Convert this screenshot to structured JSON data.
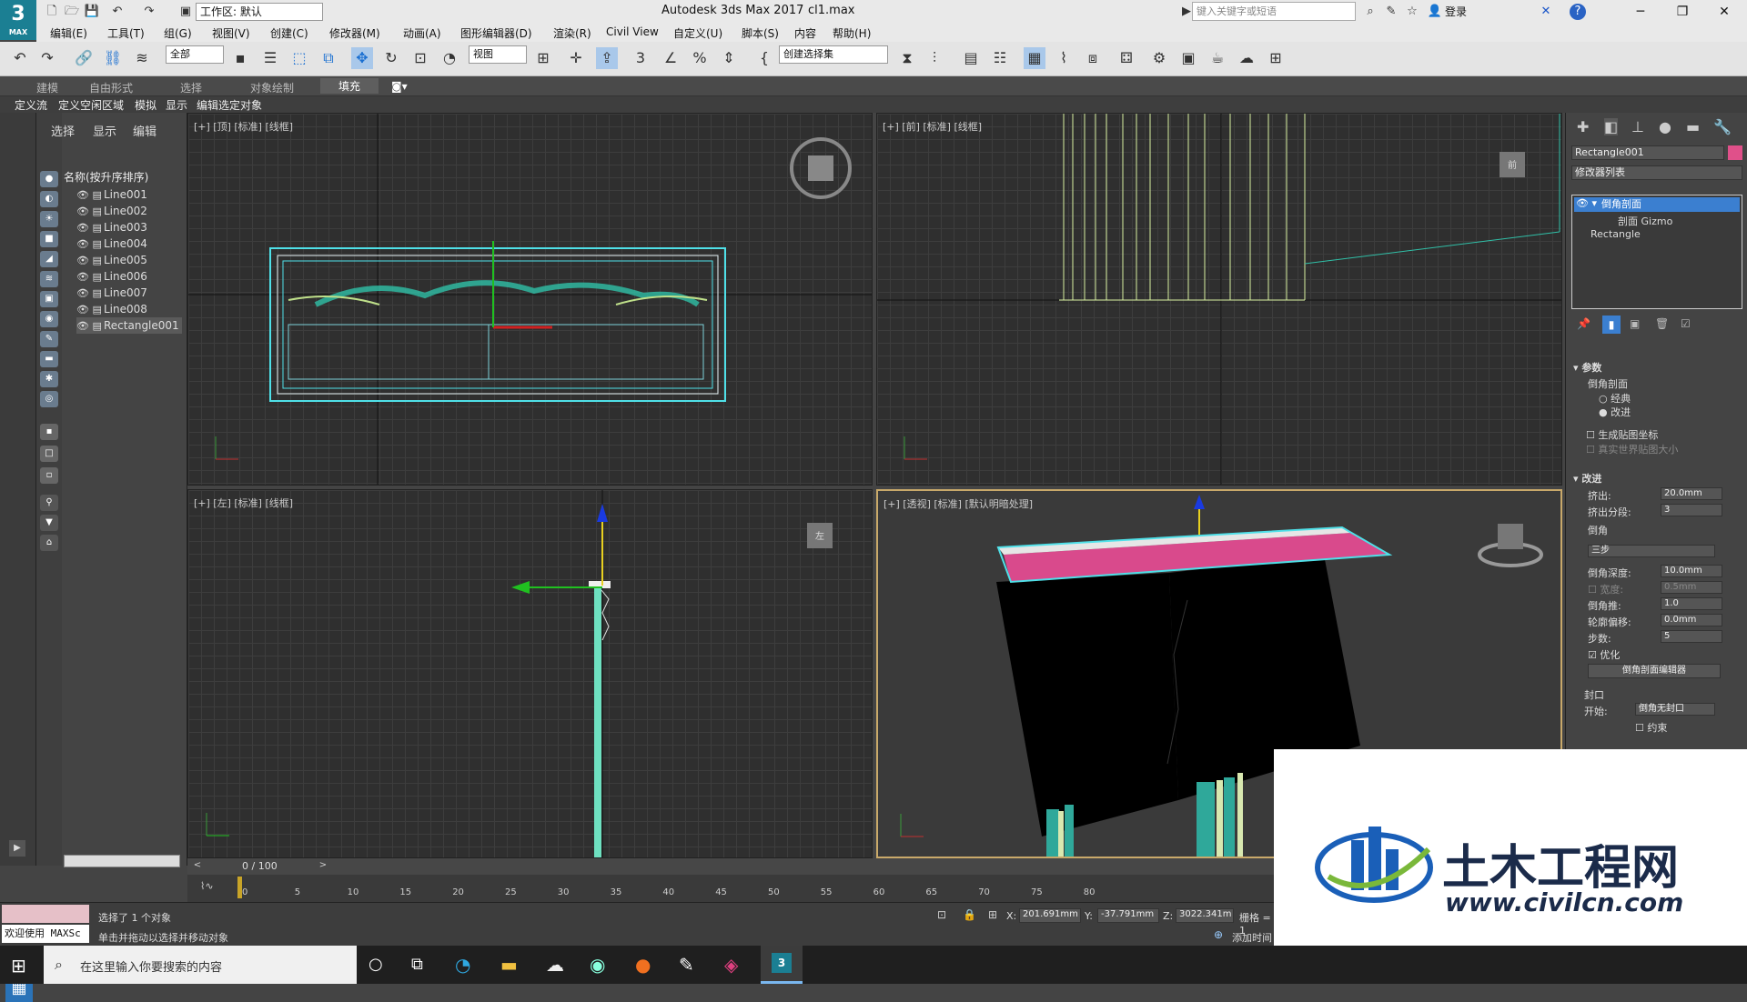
{
  "title_bar": {
    "logo_text": "3",
    "logo_sub": "MAX",
    "workspace": "工作区: 默认",
    "app_title": "Autodesk 3ds Max 2017",
    "file_name": "cl1.max",
    "search_placeholder": "键入关键字或短语",
    "login_label": "登录",
    "help_icon": "?"
  },
  "menu": [
    "编辑(E)",
    "工具(T)",
    "组(G)",
    "视图(V)",
    "创建(C)",
    "修改器(M)",
    "动画(A)",
    "图形编辑器(D)",
    "渲染(R)",
    "Civil View",
    "自定义(U)",
    "脚本(S)",
    "内容",
    "帮助(H)"
  ],
  "toolbar": {
    "filter_dropdown": "全部",
    "view_dropdown": "视图",
    "selection_set": "创建选择集"
  },
  "ribbon_tabs": [
    "建模",
    "自由形式",
    "选择",
    "对象绘制",
    "填充"
  ],
  "ribbon_sub": [
    "定义流",
    "定义空闲区域",
    "模拟",
    "显示",
    "编辑选定对象"
  ],
  "scene_explorer": {
    "tabs": [
      "选择",
      "显示",
      "编辑"
    ],
    "header": "名称(按升序排序)",
    "items": [
      "Line001",
      "Line002",
      "Line003",
      "Line004",
      "Line005",
      "Line006",
      "Line007",
      "Line008",
      "Rectangle001"
    ]
  },
  "viewports": {
    "top": "[+] [顶] [标准] [线框]",
    "front": "[+] [前] [标准] [线框]",
    "left": "[+] [左] [标准] [线框]",
    "perspective": "[+] [透视] [标准] [默认明暗处理]",
    "left_cube_label": "左",
    "front_cube_label": "前"
  },
  "command_panel": {
    "object_name": "Rectangle001",
    "object_color": "#e0508a",
    "modifier_list": "修改器列表",
    "stack": [
      "倒角剖面",
      "剖面 Gizmo",
      "Rectangle"
    ],
    "params_title": "参数",
    "bevel_profile": "倒角剖面",
    "option_classic": "经典",
    "option_improved": "改进",
    "gen_mapping": "生成贴图坐标",
    "real_world": "真实世界贴图大小",
    "improved_title": "改进",
    "extrude_label": "挤出:",
    "extrude_value": "20.0mm",
    "extrude_seg_label": "挤出分段:",
    "extrude_seg_value": "3",
    "bevel_title": "倒角",
    "bevel_type": "三步",
    "bevel_depth_label": "倒角深度:",
    "bevel_depth_value": "10.0mm",
    "width_label": "宽度:",
    "width_value": "0.5mm",
    "bevel_push_label": "倒角推:",
    "bevel_push_value": "1.0",
    "contour_label": "轮廓偏移:",
    "contour_value": "0.0mm",
    "steps_label": "步数:",
    "steps_value": "5",
    "optimize": "优化",
    "editor_button": "倒角剖面编辑器",
    "cap_title": "封口",
    "start_label": "开始:",
    "start_value": "倒角无封口",
    "constrain": "约束"
  },
  "timeline": {
    "frame": "0 / 100",
    "ticks": [
      "0",
      "5",
      "10",
      "15",
      "20",
      "25",
      "30",
      "35",
      "40",
      "45",
      "50",
      "55",
      "60",
      "65",
      "70",
      "75",
      "80"
    ]
  },
  "status": {
    "welcome": "欢迎使用 MAXSc",
    "selected": "选择了 1 个对象",
    "hint": "单击并拖动以选择并移动对象",
    "x_label": "X:",
    "x_value": "201.691mm",
    "y_label": "Y:",
    "y_value": "-37.791mm",
    "z_label": "Z:",
    "z_value": "3022.341m",
    "grid_label": "栅格 = 1",
    "add_time": "添加时间"
  },
  "taskbar": {
    "search_text": "在这里输入你要搜索的内容"
  },
  "watermark": {
    "title": "土木工程网",
    "url": "www.civilcn.com"
  }
}
